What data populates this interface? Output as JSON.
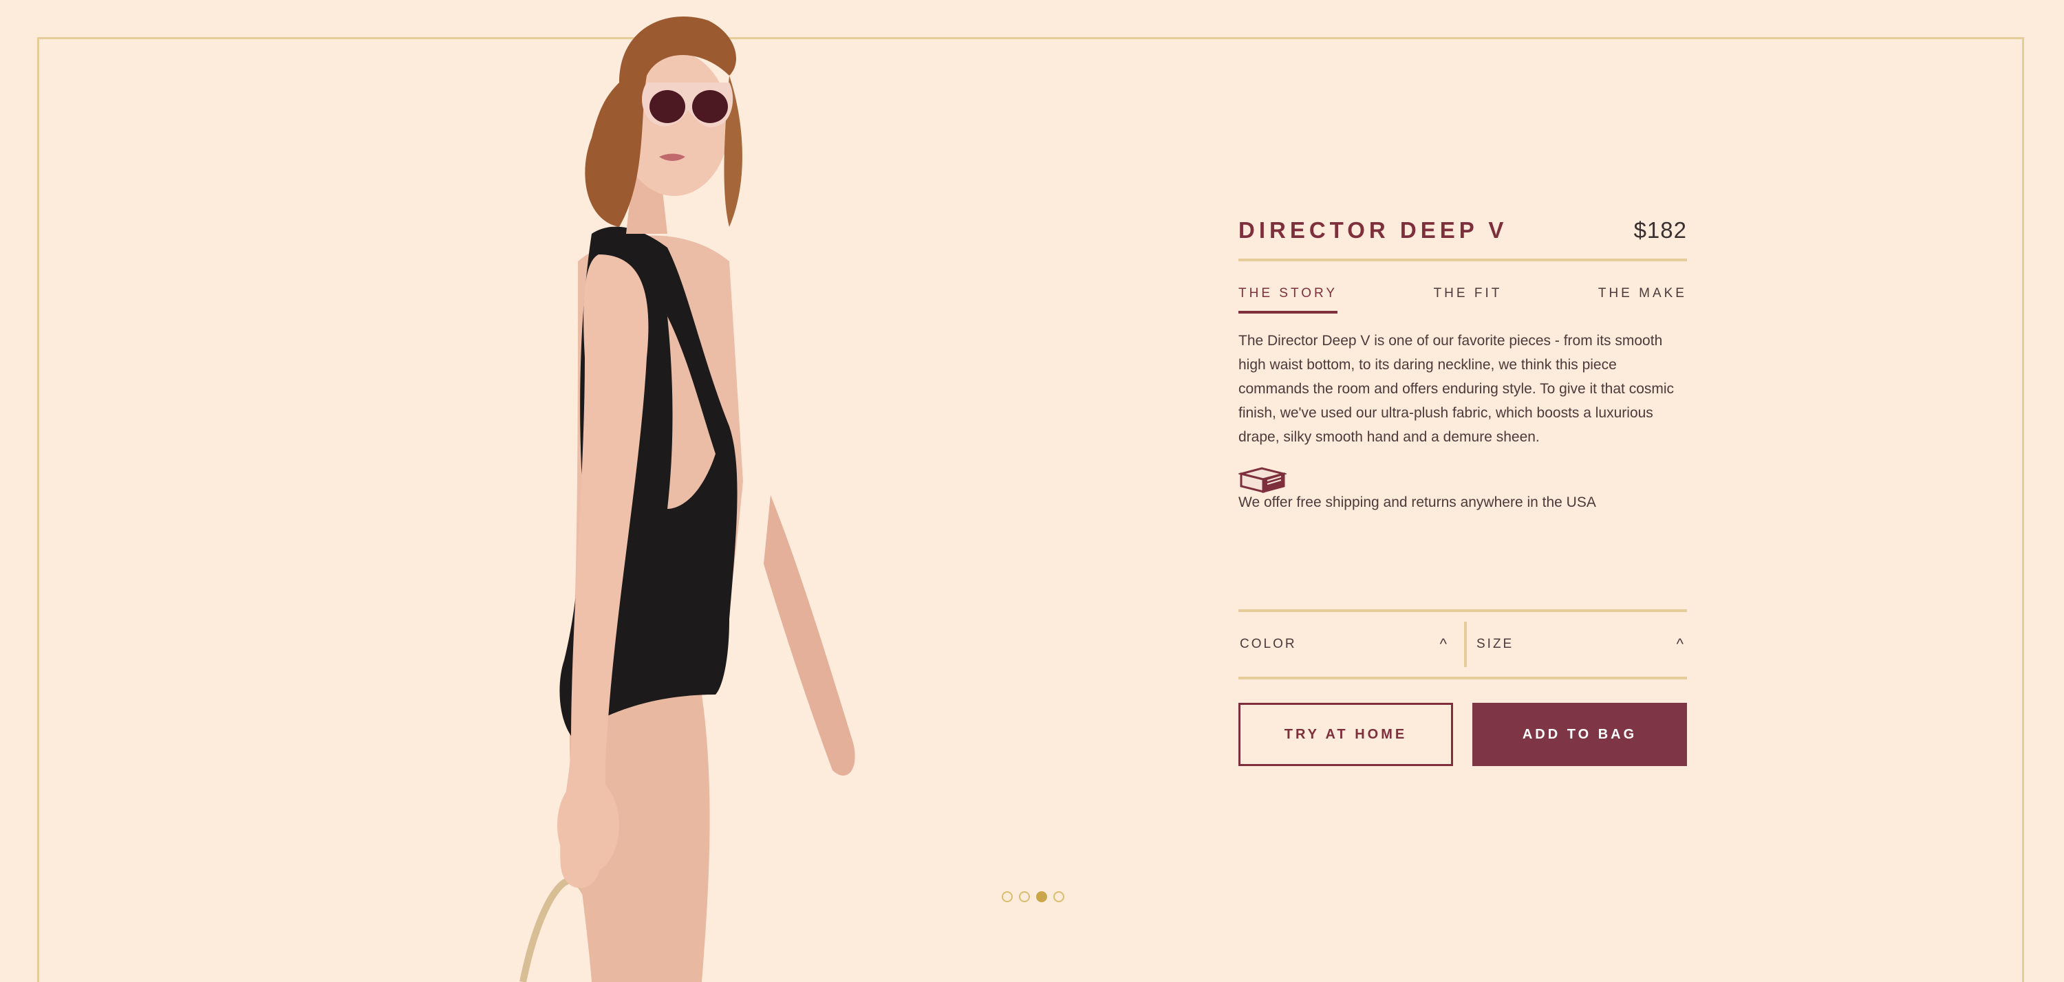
{
  "product": {
    "title": "DIRECTOR DEEP V",
    "price": "$182"
  },
  "tabs": [
    {
      "label": "THE STORY",
      "active": true
    },
    {
      "label": "THE FIT",
      "active": false
    },
    {
      "label": "THE MAKE",
      "active": false
    }
  ],
  "story": {
    "description": "The Director Deep V is one of our favorite pieces - from its smooth high waist bottom, to its daring neckline, we think this piece commands the room and offers enduring style. To give it that cosmic finish, we've used our ultra-plush fabric, which boosts a luxurious drape, silky smooth hand and a demure sheen."
  },
  "shipping": {
    "icon": "box-icon",
    "text": "We offer free shipping and returns anywhere in the USA"
  },
  "selectors": {
    "color_label": "COLOR",
    "size_label": "SIZE",
    "caret": "^"
  },
  "actions": {
    "try_label": "TRY AT HOME",
    "add_label": "ADD TO BAG"
  },
  "carousel": {
    "total": 4,
    "active_index": 2
  },
  "colors": {
    "background": "#FDEBDC",
    "accent": "#7E2F3C",
    "gold": "#E6CC98"
  }
}
